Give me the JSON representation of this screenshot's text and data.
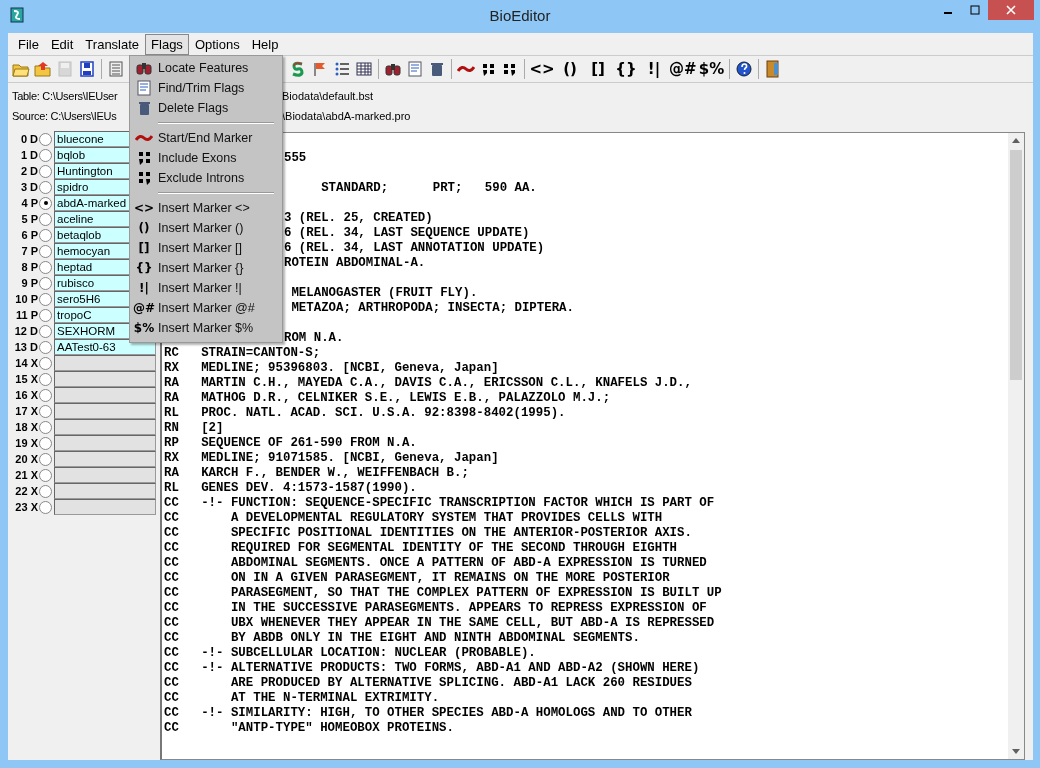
{
  "window": {
    "title": "BioEditor"
  },
  "menu": [
    {
      "label": "File",
      "selected": false
    },
    {
      "label": "Edit",
      "selected": false
    },
    {
      "label": "Translate",
      "selected": false
    },
    {
      "label": "Flags",
      "selected": true
    },
    {
      "label": "Options",
      "selected": false
    },
    {
      "label": "Help",
      "selected": false
    }
  ],
  "toolbar_left": [
    {
      "disabled": false
    },
    {
      "disabled": false
    },
    {
      "disabled": true
    },
    {
      "disabled": false
    },
    {
      "disabled": false
    }
  ],
  "toolbar_right": [
    {
      "kind": "icon"
    },
    {
      "kind": "icon"
    },
    {
      "kind": "icon"
    },
    {
      "kind": "icon"
    },
    {
      "kind": "icon"
    },
    {
      "kind": "icon"
    },
    {
      "kind": "icon"
    },
    {
      "kind": "icon"
    },
    {
      "kind": "icon"
    },
    {
      "kind": "icon"
    },
    {
      "kind": "glyph",
      "glyph": "<>"
    },
    {
      "kind": "glyph",
      "glyph": "()"
    },
    {
      "kind": "glyph",
      "glyph": "[]"
    },
    {
      "kind": "glyph",
      "glyph": "{}"
    },
    {
      "kind": "glyph",
      "glyph": "!|"
    },
    {
      "kind": "glyph",
      "glyph": "@#"
    },
    {
      "kind": "glyph",
      "glyph": "$%"
    },
    {
      "kind": "icon"
    },
    {
      "kind": "icon"
    }
  ],
  "info": [
    {
      "left": "Table: C:\\Users\\IEUser",
      "right": "Biodata\\default.bst"
    },
    {
      "left": "Source: C:\\Users\\IEUs",
      "right": "\\Biodata\\abdA-marked.pro"
    }
  ],
  "files": [
    {
      "index": "0",
      "type": "D",
      "name": "bluecone",
      "selected": false
    },
    {
      "index": "1",
      "type": "D",
      "name": "bqlob",
      "selected": false
    },
    {
      "index": "2",
      "type": "D",
      "name": "Huntington",
      "selected": false
    },
    {
      "index": "3",
      "type": "D",
      "name": "spidro",
      "selected": false
    },
    {
      "index": "4",
      "type": "P",
      "name": "abdA-marked",
      "selected": true
    },
    {
      "index": "5",
      "type": "P",
      "name": "aceline",
      "selected": false
    },
    {
      "index": "6",
      "type": "P",
      "name": "betaqlob",
      "selected": false
    },
    {
      "index": "7",
      "type": "P",
      "name": "hemocyan",
      "selected": false
    },
    {
      "index": "8",
      "type": "P",
      "name": "heptad",
      "selected": false
    },
    {
      "index": "9",
      "type": "P",
      "name": "rubisco",
      "selected": false
    },
    {
      "index": "10",
      "type": "P",
      "name": "sero5H6",
      "selected": false
    },
    {
      "index": "11",
      "type": "P",
      "name": "tropoC",
      "selected": false
    },
    {
      "index": "12",
      "type": "D",
      "name": "SEXHORM",
      "selected": false
    },
    {
      "index": "13",
      "type": "D",
      "name": "AATest0-63",
      "selected": false
    },
    {
      "index": "14",
      "type": "X",
      "selected": false
    },
    {
      "index": "15",
      "type": "X",
      "selected": false
    },
    {
      "index": "16",
      "type": "X",
      "selected": false
    },
    {
      "index": "17",
      "type": "X",
      "selected": false
    },
    {
      "index": "18",
      "type": "X",
      "selected": false
    },
    {
      "index": "19",
      "type": "X",
      "selected": false
    },
    {
      "index": "20",
      "type": "X",
      "selected": false
    },
    {
      "index": "21",
      "type": "X",
      "selected": false
    },
    {
      "index": "22",
      "type": "X",
      "selected": false
    },
    {
      "index": "23",
      "type": "X",
      "selected": false
    }
  ],
  "text_lines": [
    {
      "kind": "partial",
      "text": "555"
    },
    {
      "kind": "blank"
    },
    {
      "kind": "partial",
      "text": "     STANDARD;      PRT;   590 AA."
    },
    {
      "kind": "blank"
    },
    {
      "kind": "partial",
      "text": "3 (REL. 25, CREATED)"
    },
    {
      "kind": "partial",
      "text": "6 (REL. 34, LAST SEQUENCE UPDATE)"
    },
    {
      "kind": "partial",
      "text": "6 (REL. 34, LAST ANNOTATION UPDATE)"
    },
    {
      "kind": "partial",
      "text": "ROTEIN ABDOMINAL-A."
    },
    {
      "kind": "blank"
    },
    {
      "kind": "partial",
      "text": " MELANOGASTER (FRUIT FLY)."
    },
    {
      "kind": "partial",
      "text": " METAZOA; ARTHROPODA; INSECTA; DIPTERA."
    },
    {
      "kind": "blank"
    },
    {
      "kind": "partial",
      "text": "ROM N.A."
    },
    {
      "kind": "line",
      "text": "RC   STRAIN=CANTON-S;"
    },
    {
      "kind": "line",
      "text": "RX   MEDLINE; 95396803. [NCBI, Geneva, Japan]"
    },
    {
      "kind": "line",
      "text": "RA   MARTIN C.H., MAYEDA C.A., DAVIS C.A., ERICSSON C.L., KNAFELS J.D.,"
    },
    {
      "kind": "line",
      "text": "RA   MATHOG D.R., CELNIKER S.E., LEWIS E.B., PALAZZOLO M.J.;"
    },
    {
      "kind": "line",
      "text": "RL   PROC. NATL. ACAD. SCI. U.S.A. 92:8398-8402(1995)."
    },
    {
      "kind": "line",
      "text": "RN   [2]"
    },
    {
      "kind": "line",
      "text": "RP   SEQUENCE OF 261-590 FROM N.A."
    },
    {
      "kind": "line",
      "text": "RX   MEDLINE; 91071585. [NCBI, Geneva, Japan]"
    },
    {
      "kind": "line",
      "text": "RA   KARCH F., BENDER W., WEIFFENBACH B.;"
    },
    {
      "kind": "line",
      "text": "RL   GENES DEV. 4:1573-1587(1990)."
    },
    {
      "kind": "line",
      "text": "CC   -!- FUNCTION: SEQUENCE-SPECIFIC TRANSCRIPTION FACTOR WHICH IS PART OF"
    },
    {
      "kind": "line",
      "text": "CC       A DEVELOPMENTAL REGULATORY SYSTEM THAT PROVIDES CELLS WITH"
    },
    {
      "kind": "line",
      "text": "CC       SPECIFIC POSITIONAL IDENTITIES ON THE ANTERIOR-POSTERIOR AXIS."
    },
    {
      "kind": "line",
      "text": "CC       REQUIRED FOR SEGMENTAL IDENTITY OF THE SECOND THROUGH EIGHTH"
    },
    {
      "kind": "line",
      "text": "CC       ABDOMINAL SEGMENTS. ONCE A PATTERN OF ABD-A EXPRESSION IS TURNED"
    },
    {
      "kind": "line",
      "text": "CC       ON IN A GIVEN PARASEGMENT, IT REMAINS ON THE MORE POSTERIOR"
    },
    {
      "kind": "line",
      "text": "CC       PARASEGMENT, SO THAT THE COMPLEX PATTERN OF EXPRESSION IS BUILT UP"
    },
    {
      "kind": "line",
      "text": "CC       IN THE SUCCESSIVE PARASEGMENTS. APPEARS TO REPRESS EXPRESSION OF"
    },
    {
      "kind": "line",
      "text": "CC       UBX WHENEVER THEY APPEAR IN THE SAME CELL, BUT ABD-A IS REPRESSED"
    },
    {
      "kind": "line",
      "text": "CC       BY ABDB ONLY IN THE EIGHT AND NINTH ABDOMINAL SEGMENTS."
    },
    {
      "kind": "line",
      "text": "CC   -!- SUBCELLULAR LOCATION: NUCLEAR (PROBABLE)."
    },
    {
      "kind": "line",
      "text": "CC   -!- ALTERNATIVE PRODUCTS: TWO FORMS, ABD-A1 AND ABD-A2 (SHOWN HERE)"
    },
    {
      "kind": "line",
      "text": "CC       ARE PRODUCED BY ALTERNATIVE SPLICING. ABD-A1 LACK 260 RESIDUES"
    },
    {
      "kind": "line",
      "text": "CC       AT THE N-TERMINAL EXTRIMITY."
    },
    {
      "kind": "line",
      "text": "CC   -!- SIMILARITY: HIGH, TO OTHER SPECIES ABD-A HOMOLOGS AND TO OTHER"
    },
    {
      "kind": "line",
      "text": "CC       \"ANTP-TYPE\" HOMEOBOX PROTEINS."
    }
  ],
  "flags_menu": [
    {
      "kind": "icon",
      "label": "Locate Features"
    },
    {
      "kind": "icon",
      "label": "Find/Trim Flags"
    },
    {
      "kind": "icon",
      "label": "Delete Flags"
    },
    {
      "kind": "separator"
    },
    {
      "kind": "icon",
      "label": "Start/End Marker"
    },
    {
      "kind": "icon",
      "label": "Include Exons"
    },
    {
      "kind": "icon",
      "label": "Exclude Introns"
    },
    {
      "kind": "separator"
    },
    {
      "kind": "glyph",
      "glyph": "<>",
      "label": "Insert Marker <>"
    },
    {
      "kind": "glyph",
      "glyph": "()",
      "label": "Insert Marker ()"
    },
    {
      "kind": "glyph",
      "glyph": "[]",
      "label": "Insert Marker []"
    },
    {
      "kind": "glyph",
      "glyph": "{}",
      "label": "Insert Marker {}"
    },
    {
      "kind": "glyph",
      "glyph": "!|",
      "label": "Insert Marker !|"
    },
    {
      "kind": "glyph",
      "glyph": "@#",
      "label": "Insert Marker @#"
    },
    {
      "kind": "glyph",
      "glyph": "$%",
      "label": "Insert Marker $%"
    }
  ]
}
